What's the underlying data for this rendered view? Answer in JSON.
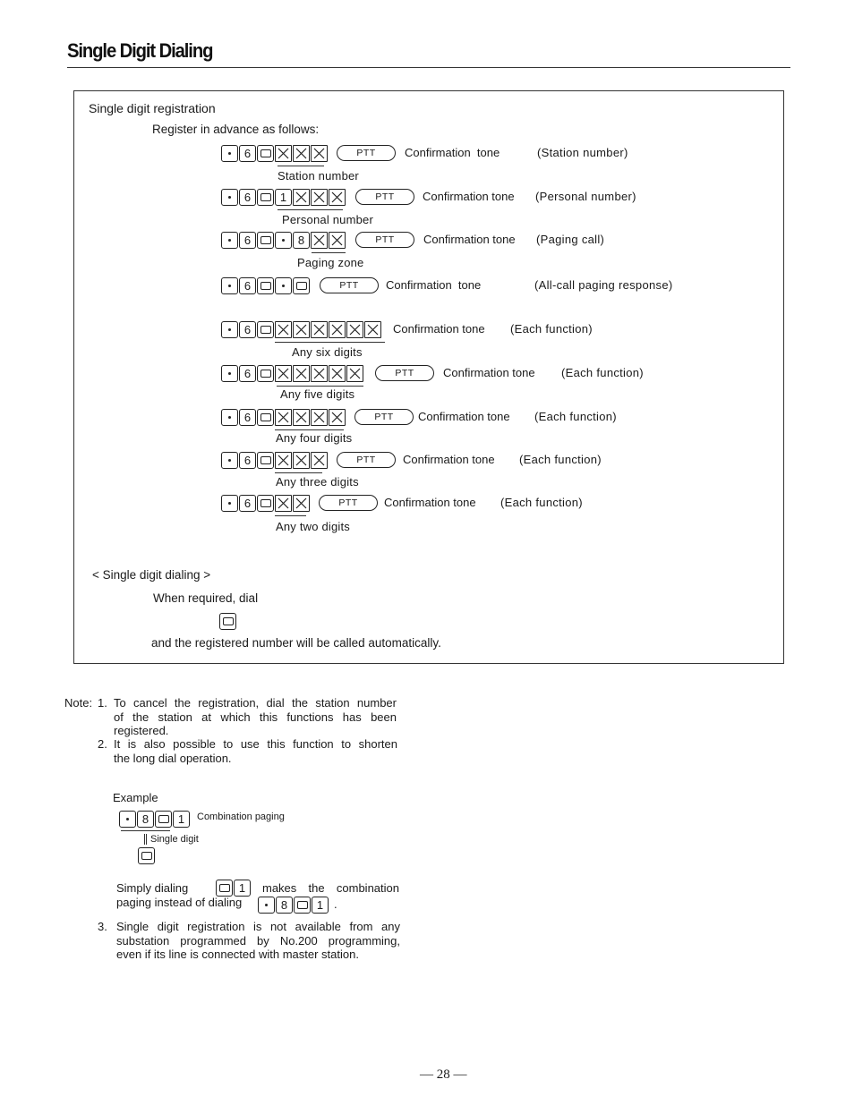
{
  "page": {
    "title": "Single Digit Dialing",
    "page_number": "— 28 —"
  },
  "registration": {
    "heading": "Single digit registration",
    "intro": "Register in advance as follows:",
    "rows": [
      {
        "keys": [
          "dot",
          "6",
          "0",
          "x",
          "x",
          "x"
        ],
        "ptt": "PTT",
        "confirmation": "Confirmation  tone",
        "purpose": "(Station number)",
        "label": "Station number"
      },
      {
        "keys": [
          "dot",
          "6",
          "0",
          "1",
          "x",
          "x",
          "x"
        ],
        "ptt": "PTT",
        "confirmation": "Confirmation tone",
        "purpose": "(Personal number)",
        "label": "Personal number"
      },
      {
        "keys": [
          "dot",
          "6",
          "0",
          "dot",
          "8",
          "x",
          "x"
        ],
        "ptt": "PTT",
        "confirmation": "Confirmation tone",
        "purpose": "(Paging call)",
        "label": "Paging zone"
      },
      {
        "keys": [
          "dot",
          "6",
          "0",
          "dot",
          "0"
        ],
        "ptt": "PTT",
        "confirmation": "Confirmation  tone",
        "purpose": "(All-call paging response)",
        "label": ""
      },
      {
        "keys": [
          "dot",
          "6",
          "0",
          "x",
          "x",
          "x",
          "x",
          "x",
          "x"
        ],
        "ptt": "",
        "confirmation": "Confirmation tone",
        "purpose": "(Each function)",
        "label": "Any six digits"
      },
      {
        "keys": [
          "dot",
          "6",
          "0",
          "x",
          "x",
          "x",
          "x",
          "x"
        ],
        "ptt": "PTT",
        "confirmation": "Confirmation tone",
        "purpose": "(Each function)",
        "label": "Any five digits"
      },
      {
        "keys": [
          "dot",
          "6",
          "0",
          "x",
          "x",
          "x",
          "x"
        ],
        "ptt": "PTT",
        "confirmation": "Confirmation tone",
        "purpose": "(Each function)",
        "label": "Any four digits"
      },
      {
        "keys": [
          "dot",
          "6",
          "0",
          "x",
          "x",
          "x"
        ],
        "ptt": "PTT",
        "confirmation": "Confirmation tone",
        "purpose": "(Each function)",
        "label": "Any three digits"
      },
      {
        "keys": [
          "dot",
          "6",
          "0",
          "x",
          "x"
        ],
        "ptt": "PTT",
        "confirmation": "Confirmation tone",
        "purpose": "(Each function)",
        "label": "Any two digits"
      }
    ]
  },
  "dialing": {
    "heading": "< Single digit dialing >",
    "instruction": "When required, dial",
    "key": "0",
    "result": "and the registered number will be called automatically."
  },
  "notes": {
    "prefix": "Note:",
    "items": [
      {
        "num": "1.",
        "lines": [
          "To cancel the registration, dial the station number",
          "of the station at which this functions has been",
          "registered."
        ]
      },
      {
        "num": "2.",
        "lines": [
          "It is also possible to use this function to shorten",
          "the long dial operation."
        ]
      },
      {
        "num": "3.",
        "lines": [
          "Single digit registration is not available from any",
          "substation programmed by No.200 programming,",
          "even if its line is connected with master station."
        ]
      }
    ],
    "example": {
      "heading": "Example",
      "keys": [
        "dot",
        "8",
        "0",
        "1"
      ],
      "keys_caption": "Combination paging",
      "single_digit_label": "Single digit",
      "single_key": "0",
      "text_a": "Simply  dialing",
      "short_keys": [
        "0",
        "1"
      ],
      "text_b": "makes  the  combination",
      "text_c": "paging instead of dialing",
      "long_keys": [
        "dot",
        "8",
        "0",
        "1"
      ],
      "text_end": "."
    }
  }
}
